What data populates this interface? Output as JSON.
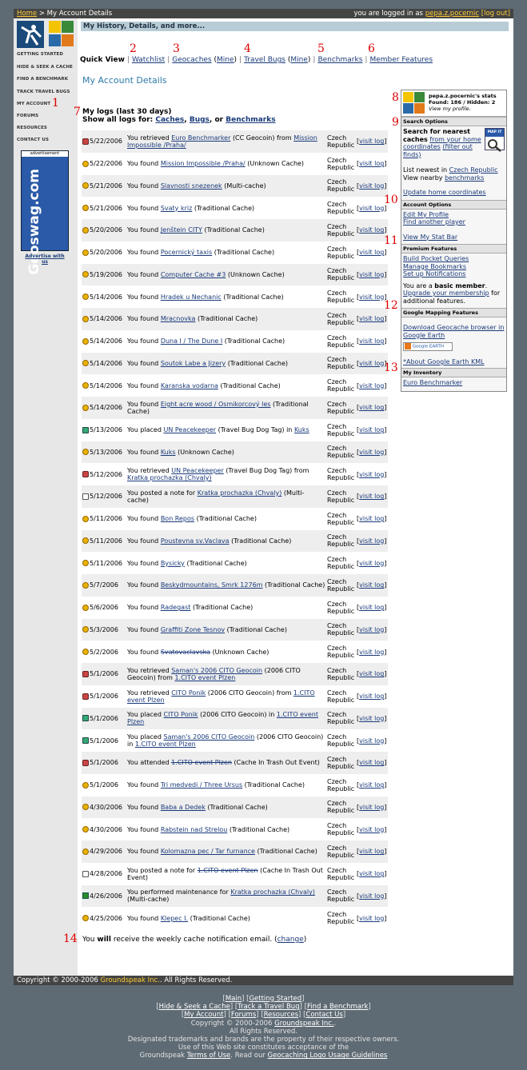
{
  "topbar": {
    "home": "Home",
    "crumb": "> My Account Details",
    "logged_in": "you are logged in as",
    "user": "pepa.z.pocernic",
    "logout": "[log out]"
  },
  "sidebar": {
    "nav": [
      "GETTING STARTED",
      "HIDE & SEEK A CACHE",
      "FIND A BENCHMARK",
      "TRACK TRAVEL BUGS",
      "MY ACCOUNT",
      "FORUMS",
      "RESOURCES",
      "CONTACT US"
    ],
    "ad_label": "advertisement",
    "ad_text": "Geoswag.com",
    "advertise": "Advertise with us"
  },
  "header_bar": "My History, Details, and more...",
  "tabs": {
    "quick": "Quick View",
    "watchlist": "Watchlist",
    "geocaches": "Geocaches",
    "mine": "Mine",
    "travel_bugs": "Travel Bugs",
    "benchmarks": "Benchmarks",
    "member_features": "Member Features"
  },
  "page_title": "My Account Details",
  "logs_heading": "My logs (last 30 days)",
  "show_all": {
    "prefix": "Show all logs for:",
    "caches": "Caches",
    "bugs": "Bugs",
    "or": ", or",
    "benchmarks": "Benchmarks"
  },
  "country": "Czech Republic",
  "visit_log": "visit log",
  "logs": [
    {
      "icon": "retrieve",
      "date": "5/22/2006",
      "pre": "You retrieved",
      "link": "Euro Benchmarker",
      "mid": "(CC Geocoin) from",
      "link2": "Mission Impossible /Praha/",
      "post": ""
    },
    {
      "icon": "found",
      "date": "5/22/2006",
      "pre": "You found",
      "link": "Mission Impossible /Praha/",
      "mid": "",
      "link2": "",
      "post": "(Unknown Cache)"
    },
    {
      "icon": "found",
      "date": "5/21/2006",
      "pre": "You found",
      "link": "Slavnosti snezenek",
      "mid": "",
      "link2": "",
      "post": "(Multi-cache)"
    },
    {
      "icon": "found",
      "date": "5/21/2006",
      "pre": "You found",
      "link": "Svaty kriz",
      "mid": "",
      "link2": "",
      "post": "(Traditional Cache)"
    },
    {
      "icon": "found",
      "date": "5/20/2006",
      "pre": "You found",
      "link": "Jenštein CITY",
      "mid": "",
      "link2": "",
      "post": "(Traditional Cache)"
    },
    {
      "icon": "found",
      "date": "5/20/2006",
      "pre": "You found",
      "link": "Pocernický taxis",
      "mid": "",
      "link2": "",
      "post": "(Traditional Cache)"
    },
    {
      "icon": "found",
      "date": "5/19/2006",
      "pre": "You found",
      "link": "Computer Cache #3",
      "mid": "",
      "link2": "",
      "post": "(Unknown Cache)"
    },
    {
      "icon": "found",
      "date": "5/14/2006",
      "pre": "You found",
      "link": "Hradek u Nechanic",
      "mid": "",
      "link2": "",
      "post": "(Traditional Cache)"
    },
    {
      "icon": "found",
      "date": "5/14/2006",
      "pre": "You found",
      "link": "Mracnovka",
      "mid": "",
      "link2": "",
      "post": "(Traditional Cache)"
    },
    {
      "icon": "found",
      "date": "5/14/2006",
      "pre": "You found",
      "link": "Duna I / The Dune I",
      "mid": "",
      "link2": "",
      "post": "(Traditional Cache)"
    },
    {
      "icon": "found",
      "date": "5/14/2006",
      "pre": "You found",
      "link": "Soutok Labe a Jizery",
      "mid": "",
      "link2": "",
      "post": "(Traditional Cache)"
    },
    {
      "icon": "found",
      "date": "5/14/2006",
      "pre": "You found",
      "link": "Karanska vodarna",
      "mid": "",
      "link2": "",
      "post": "(Traditional Cache)"
    },
    {
      "icon": "found",
      "date": "5/14/2006",
      "pre": "You found",
      "link": "Eight acre wood / Osmikorcový les",
      "mid": "",
      "link2": "",
      "post": "(Traditional Cache)"
    },
    {
      "icon": "placed",
      "date": "5/13/2006",
      "pre": "You placed",
      "link": "UN Peacekeeper",
      "mid": "(Travel Bug Dog Tag) in",
      "link2": "Kuks",
      "post": ""
    },
    {
      "icon": "found",
      "date": "5/13/2006",
      "pre": "You found",
      "link": "Kuks",
      "mid": "",
      "link2": "",
      "post": "(Unknown Cache)"
    },
    {
      "icon": "retrieve",
      "date": "5/12/2006",
      "pre": "You retrieved",
      "link": "UN Peacekeeper",
      "mid": "(Travel Bug Dog Tag) from",
      "link2": "Kratka prochazka (Chvaly)",
      "post": ""
    },
    {
      "icon": "note",
      "date": "5/12/2006",
      "pre": "You posted a note for",
      "link": "Kratka prochazka (Chvaly)",
      "mid": "",
      "link2": "",
      "post": "(Multi-cache)"
    },
    {
      "icon": "found",
      "date": "5/11/2006",
      "pre": "You found",
      "link": "Bon Repos",
      "mid": "",
      "link2": "",
      "post": "(Traditional Cache)"
    },
    {
      "icon": "found",
      "date": "5/11/2006",
      "pre": "You found",
      "link": "Poustevna sv.Vaclava",
      "mid": "",
      "link2": "",
      "post": "(Traditional Cache)"
    },
    {
      "icon": "found",
      "date": "5/11/2006",
      "pre": "You found",
      "link": "Bysicky",
      "mid": "",
      "link2": "",
      "post": "(Traditional Cache)"
    },
    {
      "icon": "found",
      "date": "5/7/2006",
      "pre": "You found",
      "link": "Beskydmountains, Smrk 1276m",
      "mid": "",
      "link2": "",
      "post": "(Traditional Cache)"
    },
    {
      "icon": "found",
      "date": "5/6/2006",
      "pre": "You found",
      "link": "Radegast",
      "mid": "",
      "link2": "",
      "post": "(Traditional Cache)"
    },
    {
      "icon": "found",
      "date": "5/3/2006",
      "pre": "You found",
      "link": "Graffiti Zone Tesnov",
      "mid": "",
      "link2": "",
      "post": "(Traditional Cache)"
    },
    {
      "icon": "found",
      "date": "5/2/2006",
      "pre": "You found",
      "link": "Svatovaclavska",
      "strike": true,
      "mid": "",
      "link2": "",
      "post": "(Unknown Cache)"
    },
    {
      "icon": "retrieve",
      "date": "5/1/2006",
      "pre": "You retrieved",
      "link": "Saman's 2006 CITO Geocoin",
      "mid": "(2006 CITO Geocoin) from",
      "link2": "1.CITO event Plzen",
      "post": ""
    },
    {
      "icon": "retrieve",
      "date": "5/1/2006",
      "pre": "You retrieved",
      "link": "CITO Ponik",
      "mid": "(2006 CITO Geocoin) from",
      "link2": "1.CITO event Plzen",
      "post": ""
    },
    {
      "icon": "placed",
      "date": "5/1/2006",
      "pre": "You placed",
      "link": "CITO Ponik",
      "mid": "(2006 CITO Geocoin) in",
      "link2": "1.CITO event Plzen",
      "post": ""
    },
    {
      "icon": "placed",
      "date": "5/1/2006",
      "pre": "You placed",
      "link": "Saman's 2006 CITO Geocoin",
      "mid": "(2006 CITO Geocoin) in",
      "link2": "1.CITO event Plzen",
      "post": ""
    },
    {
      "icon": "attend",
      "date": "5/1/2006",
      "pre": "You attended",
      "link": "1.CITO event Plzen",
      "strike": true,
      "mid": "",
      "link2": "",
      "post": "(Cache In Trash Out Event)"
    },
    {
      "icon": "found",
      "date": "5/1/2006",
      "pre": "You found",
      "link": "Tri medvedi / Three Ursus",
      "mid": "",
      "link2": "",
      "post": "(Traditional Cache)"
    },
    {
      "icon": "found",
      "date": "4/30/2006",
      "pre": "You found",
      "link": "Baba a Dedek",
      "mid": "",
      "link2": "",
      "post": "(Traditional Cache)"
    },
    {
      "icon": "found",
      "date": "4/30/2006",
      "pre": "You found",
      "link": "Rabstein nad Strelou",
      "mid": "",
      "link2": "",
      "post": "(Traditional Cache)"
    },
    {
      "icon": "found",
      "date": "4/29/2006",
      "pre": "You found",
      "link": "Kolomazna pec / Tar furnance",
      "mid": "",
      "link2": "",
      "post": "(Traditional Cache)"
    },
    {
      "icon": "note",
      "date": "4/28/2006",
      "pre": "You posted a note for",
      "link": "1.CITO event Plzen",
      "strike": true,
      "mid": "",
      "link2": "",
      "post": "(Cache In Trash Out Event)"
    },
    {
      "icon": "maint",
      "date": "4/26/2006",
      "pre": "You performed maintenance for",
      "link": "Kratka prochazka (Chvaly)",
      "mid": "",
      "link2": "",
      "post": "(Multi-cache)"
    },
    {
      "icon": "found",
      "date": "4/25/2006",
      "pre": "You found",
      "link": "Klepec I.",
      "mid": "",
      "link2": "",
      "post": "(Traditional Cache)"
    }
  ],
  "stats": {
    "title": "pepa.z.pocernic's stats",
    "found": "Found: 186 / Hidden: 2",
    "view_profile": "View my profile."
  },
  "search_options": {
    "header": "Search Options",
    "map_it": "MAP IT",
    "search_bold": "Search for nearest caches",
    "from_home": "from your home coordinates",
    "filter": "(filter out finds)",
    "list_newest": "List newest in",
    "czech": "Czech Republic",
    "view_nearby": "View nearby",
    "benchmarks": "benchmarks",
    "update_home": "Update home coordinates"
  },
  "account_options": {
    "header": "Account Options",
    "edit_profile": "Edit My Profile",
    "find_player": "Find another player",
    "stat_bar": "View My Stat Bar"
  },
  "premium": {
    "header": "Premium Features",
    "pocket": "Build Pocket Queries",
    "bookmarks": "Manage Bookmarks",
    "notifications": "Set up Notifications",
    "you_are": "You are a",
    "basic": "basic member",
    "upgrade": "Upgrade your membership",
    "for_more": "for additional features."
  },
  "mapping": {
    "header": "Google Mapping Features",
    "download": "Download Geocache browser in Google Earth",
    "ge_button": "Google EARTH",
    "about_kml": "*About Google Earth KML"
  },
  "inventory": {
    "header": "My Inventory",
    "item": "Euro Benchmarker"
  },
  "notice": {
    "pre": "You",
    "will": "will",
    "post": "receive the weekly cache notification email. (",
    "change": "change",
    "close": ")"
  },
  "copyright_bar": {
    "text": "Copyright © 2000-2006",
    "company": "Groundspeak Inc.",
    "rest": "All Rights Reserved."
  },
  "footer": {
    "line1": [
      "Main",
      "Getting Started"
    ],
    "line2": [
      "Hide & Seek a Cache",
      "Track a Travel Bug",
      "Find a Benchmark"
    ],
    "line3": [
      "My Account",
      "Forums",
      "Resources",
      "Contact Us"
    ],
    "copyright": "Copyright © 2000-2006",
    "company": "Groundspeak Inc.",
    "rights": "All Rights Reserved.",
    "trademarks": "Designated trademarks and brands are the property of their respective owners.",
    "acceptance": "Use of this Web site constitutes acceptance of the",
    "terms_pre": "Groundspeak",
    "terms": "Terms of Use",
    "read_our": ". Read our",
    "logo_guidelines": "Geocaching Logo Usage Guidelines"
  },
  "annotations": [
    "1",
    "2",
    "3",
    "4",
    "5",
    "6",
    "7",
    "8",
    "9",
    "10",
    "11",
    "12",
    "13",
    "14"
  ],
  "colors": {
    "annotation": "#dd0000",
    "link": "#1a3a7a",
    "title": "#2f7aa8",
    "topbar": "#444444",
    "header_bar": "#b8ccd6"
  }
}
